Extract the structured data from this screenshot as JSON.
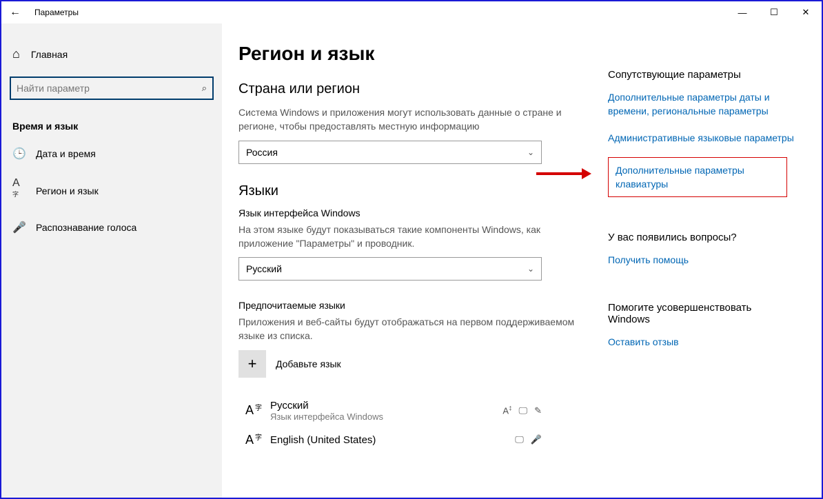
{
  "window": {
    "title": "Параметры"
  },
  "sidebar": {
    "home": "Главная",
    "search_placeholder": "Найти параметр",
    "section": "Время и язык",
    "items": [
      {
        "label": "Дата и время"
      },
      {
        "label": "Регион и язык"
      },
      {
        "label": "Распознавание голоса"
      }
    ]
  },
  "main": {
    "title": "Регион и язык",
    "region": {
      "heading": "Страна или регион",
      "description": "Система Windows и приложения могут использовать данные о стране и регионе, чтобы предоставлять местную информацию",
      "selected": "Россия"
    },
    "languages": {
      "heading": "Языки",
      "display_label": "Язык интерфейса Windows",
      "display_desc": "На этом языке будут показываться такие компоненты Windows, как приложение \"Параметры\" и проводник.",
      "display_selected": "Русский",
      "preferred_label": "Предпочитаемые языки",
      "preferred_desc": "Приложения и веб-сайты будут отображаться на первом поддерживаемом языке из списка.",
      "add_label": "Добавьте язык",
      "items": [
        {
          "name": "Русский",
          "sub": "Язык интерфейса Windows"
        },
        {
          "name": "English (United States)",
          "sub": ""
        }
      ]
    }
  },
  "related": {
    "heading": "Сопутствующие параметры",
    "links": [
      "Дополнительные параметры даты и времени, региональные параметры",
      "Административные языковые параметры",
      "Дополнительные параметры клавиатуры"
    ],
    "questions_heading": "У вас появились вопросы?",
    "help_link": "Получить помощь",
    "improve_heading": "Помогите усовершенствовать Windows",
    "feedback_link": "Оставить отзыв"
  }
}
